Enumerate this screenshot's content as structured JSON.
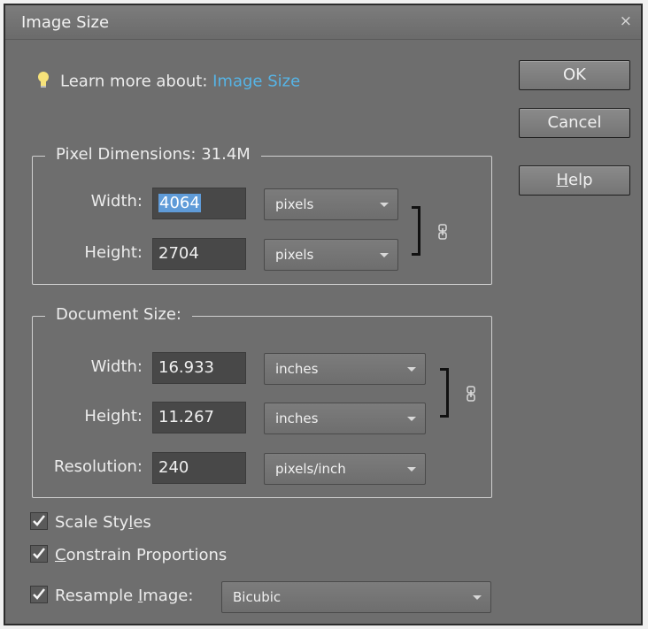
{
  "dialog": {
    "title": "Image Size",
    "close_symbol": "×"
  },
  "learn": {
    "prefix": "Learn more about:",
    "link": "Image Size"
  },
  "buttons": {
    "ok": "OK",
    "cancel": "Cancel",
    "help_u": "H",
    "help_rest": "elp"
  },
  "pixel_dimensions": {
    "legend": "Pixel Dimensions:  31.4M",
    "width_label": "Width:",
    "width_value": "4064",
    "width_unit": "pixels",
    "height_label": "Height:",
    "height_value": "2704",
    "height_unit": "pixels"
  },
  "document_size": {
    "legend": "Document Size:",
    "width_label": "Width:",
    "width_value": "16.933",
    "width_unit": "inches",
    "height_label": "Height:",
    "height_value": "11.267",
    "height_unit": "inches",
    "resolution_label": "Resolution:",
    "resolution_value": "240",
    "resolution_unit": "pixels/inch"
  },
  "options": {
    "scale_styles": {
      "before": "Scale Sty",
      "u": "l",
      "after": "es",
      "checked": true
    },
    "constrain": {
      "before": "",
      "u": "C",
      "after": "onstrain Proportions",
      "checked": true
    },
    "resample": {
      "before": "Resample ",
      "u": "I",
      "after": "mage:",
      "checked": true,
      "method": "Bicubic"
    }
  },
  "colors": {
    "dialog_bg": "#6e6e6e",
    "link": "#56b4e6",
    "selection": "#5f9bd8"
  }
}
